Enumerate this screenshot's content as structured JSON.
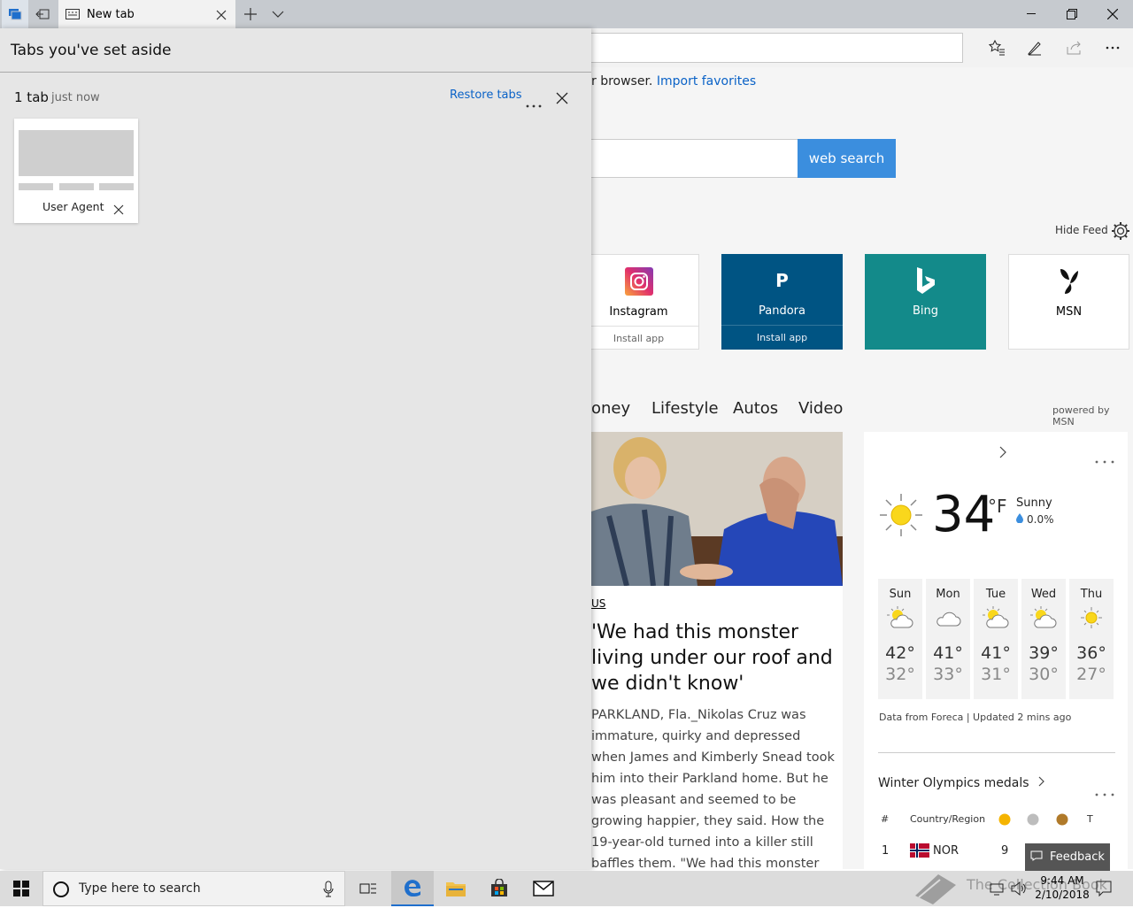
{
  "browser": {
    "tab_title": "New tab",
    "import_prefix": "r browser.",
    "import_link": "Import favorites",
    "search_button": "web search"
  },
  "feed": {
    "hide_feed": "Hide Feed",
    "powered_by": "powered by MSN",
    "tiles": [
      {
        "name": "Instagram",
        "sub": "Install app",
        "bg": "#ffffff",
        "fg": "#222222"
      },
      {
        "name": "Pandora",
        "letter": "P",
        "sub": "Install app",
        "bg": "#005483",
        "fg": "#ffffff"
      },
      {
        "name": "Bing",
        "bg": "#138a8a",
        "fg": "#ffffff"
      },
      {
        "name": "MSN",
        "bg": "#ffffff",
        "fg": "#222222"
      }
    ],
    "nav": [
      "oney",
      "Lifestyle",
      "Autos",
      "Video"
    ]
  },
  "news": {
    "category": "US",
    "title": "'We had this monster living under our roof and we didn't know'",
    "body": "PARKLAND, Fla._Nikolas Cruz was immature, quirky and depressed when James and Kimberly Snead took him into their Parkland home. But he was pleasant and seemed to be growing happier, they said. How the 19-year-old turned into a killer still baffles them. \"We had this monster living under our"
  },
  "weather": {
    "temp": "34",
    "unit": "°F",
    "condition": "Sunny",
    "precip": "0.0%",
    "source": "Data from Foreca | Updated 2 mins ago",
    "days": [
      {
        "day": "Sun",
        "hi": "42°",
        "lo": "32°",
        "icon": "partly-sunny-icon"
      },
      {
        "day": "Mon",
        "hi": "41°",
        "lo": "33°",
        "icon": "cloudy-icon"
      },
      {
        "day": "Tue",
        "hi": "41°",
        "lo": "31°",
        "icon": "partly-sunny-icon"
      },
      {
        "day": "Wed",
        "hi": "39°",
        "lo": "30°",
        "icon": "partly-sunny-icon"
      },
      {
        "day": "Thu",
        "hi": "36°",
        "lo": "27°",
        "icon": "sunny-icon"
      }
    ]
  },
  "medals": {
    "title": "Winter Olympics medals",
    "col_rank": "#",
    "col_country": "Country/Region",
    "col_total": "T",
    "row1": {
      "rank": "1",
      "country": "NOR",
      "gold": "9"
    }
  },
  "panel": {
    "title": "Tabs you've set aside",
    "count": "1 tab",
    "time": "just now",
    "restore": "Restore tabs",
    "thumb_label": "User Agent"
  },
  "feedback": "Feedback",
  "taskbar": {
    "search_placeholder": "Type here to search",
    "time": "9:44 AM",
    "date": "2/10/2018",
    "watermark": "The Collection Book"
  }
}
